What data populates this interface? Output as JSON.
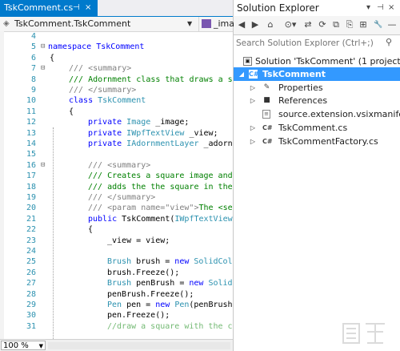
{
  "editor": {
    "tab_title": "TskComment.cs",
    "tab_pin": "⊣",
    "tab_close": "×",
    "nav_left": "TskComment.TskComment",
    "nav_right": "_image",
    "zoom": "100 %",
    "lines": [
      {
        "n": "4",
        "fold": ""
      },
      {
        "n": "5",
        "fold": "⊟"
      },
      {
        "n": "6",
        "fold": ""
      },
      {
        "n": "7",
        "fold": "⊟"
      },
      {
        "n": "8",
        "fold": ""
      },
      {
        "n": "9",
        "fold": ""
      },
      {
        "n": "10",
        "fold": ""
      },
      {
        "n": "11",
        "fold": ""
      },
      {
        "n": "12",
        "fold": ""
      },
      {
        "n": "13",
        "fold": ""
      },
      {
        "n": "14",
        "fold": ""
      },
      {
        "n": "15",
        "fold": ""
      },
      {
        "n": "16",
        "fold": "⊟"
      },
      {
        "n": "17",
        "fold": ""
      },
      {
        "n": "18",
        "fold": ""
      },
      {
        "n": "19",
        "fold": ""
      },
      {
        "n": "20",
        "fold": ""
      },
      {
        "n": "21",
        "fold": ""
      },
      {
        "n": "22",
        "fold": ""
      },
      {
        "n": "23",
        "fold": ""
      },
      {
        "n": "24",
        "fold": ""
      },
      {
        "n": "25",
        "fold": ""
      },
      {
        "n": "26",
        "fold": ""
      },
      {
        "n": "27",
        "fold": ""
      },
      {
        "n": "28",
        "fold": ""
      },
      {
        "n": "29",
        "fold": ""
      },
      {
        "n": "30",
        "fold": ""
      },
      {
        "n": "31",
        "fold": ""
      }
    ],
    "code": {
      "l5": "namespace TskComment",
      "l6": "{",
      "l7a": "/// <summary>",
      "l8a": "/// Adornment class that draws a s",
      "l9a": "/// </summary>",
      "l10a": "class ",
      "l10b": "TskComment",
      "l11": "{",
      "l12a": "private ",
      "l12b": "Image",
      "l12c": " _image;",
      "l13a": "private ",
      "l13b": "IWpfTextView",
      "l13c": " _view;",
      "l14a": "private ",
      "l14b": "IAdornmentLayer",
      "l14c": " _adornm",
      "l16": "/// <summary>",
      "l17": "/// Creates a square image and",
      "l18": "/// adds the the square in the",
      "l19": "/// </summary>",
      "l20a": "/// <param name=\"view\">",
      "l20b": "The <se",
      "l21a": "public ",
      "l21b": "TskComment(",
      "l21c": "IWpfTextView",
      "l22": "{",
      "l23": "_view = view;",
      "l25a": "Brush",
      "l25b": " brush = ",
      "l25c": "new ",
      "l25d": "SolidCol",
      "l26": "brush.Freeze();",
      "l27a": "Brush",
      "l27b": " penBrush = ",
      "l27c": "new ",
      "l27d": "Solid",
      "l28": "penBrush.Freeze();",
      "l29a": "Pen",
      "l29b": " pen = ",
      "l29c": "new ",
      "l29d": "Pen",
      "l29e": "(penBrush",
      "l30": "pen.Freeze();",
      "l31": "//draw a square with the c"
    }
  },
  "solution_explorer": {
    "title": "Solution Explorer",
    "title_buttons": [
      "▾",
      "⊣",
      "×"
    ],
    "toolbar_icons": [
      "◀",
      "▶",
      "⌂",
      "⊙▾",
      "⇄",
      "⟳",
      "⧉",
      "⎘",
      "⊞",
      "🔧",
      "—"
    ],
    "search_placeholder": "Search Solution Explorer (Ctrl+;)",
    "search_icon": "⚲",
    "tree": [
      {
        "label": "Solution 'TskComment' (1 project)",
        "icon": "solution-icon",
        "arrow": ""
      },
      {
        "label": "TskComment",
        "icon": "csharp-project-icon",
        "arrow": "◢"
      },
      {
        "label": "Properties",
        "icon": "wrench-icon",
        "arrow": "▷"
      },
      {
        "label": "References",
        "icon": "references-icon",
        "arrow": "▷"
      },
      {
        "label": "source.extension.vsixmanifest",
        "icon": "manifest-icon",
        "arrow": ""
      },
      {
        "label": "TskComment.cs",
        "icon": "csharp-file-icon",
        "arrow": "▷"
      },
      {
        "label": "TskCommentFactory.cs",
        "icon": "csharp-file-icon",
        "arrow": "▷"
      }
    ]
  },
  "colors": {
    "accent": "#007acc",
    "selection": "#3399ff",
    "keyword": "#0000ff",
    "type": "#2b91af",
    "comment": "#008000"
  }
}
